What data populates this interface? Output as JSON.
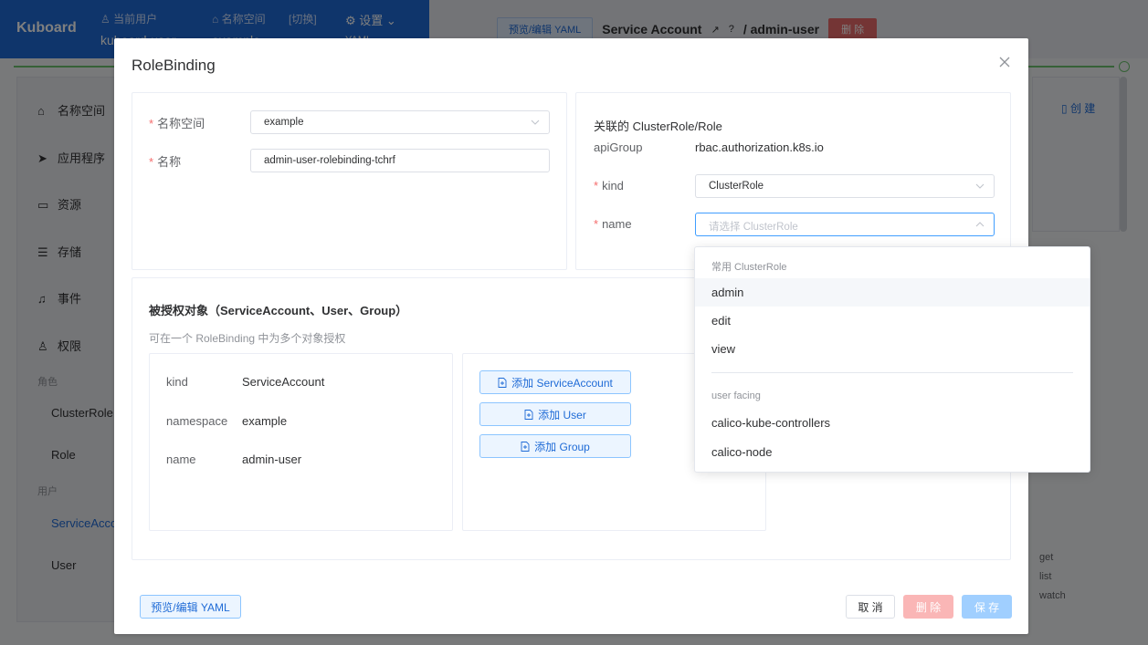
{
  "app": {
    "brand": "Kuboard",
    "current_user_label": "当前用户",
    "current_user_value": "kuboard-user",
    "namespace_label": "名称空间",
    "namespace_switch": "[切换]",
    "namespace_value": "example",
    "settings_label": "设置",
    "settings_sub": "YAML",
    "preview_yaml_btn": "预览/编辑 YAML",
    "resource_title": "Service Account",
    "resource_name": "/ admin-user",
    "delete_btn": "删 除",
    "create_btn": "创 建",
    "verbs": [
      "get",
      "list",
      "watch"
    ]
  },
  "sidebar": {
    "items": [
      {
        "label": "名称空间",
        "icon": "home-icon"
      },
      {
        "label": "应用程序",
        "icon": "send-icon"
      },
      {
        "label": "资源",
        "icon": "briefcase-icon"
      },
      {
        "label": "存储",
        "icon": "database-icon"
      },
      {
        "label": "事件",
        "icon": "bell-icon"
      },
      {
        "label": "权限",
        "icon": "user-icon"
      }
    ],
    "group_role": "角色",
    "role_items": [
      "ClusterRole",
      "Role"
    ],
    "group_user": "用户",
    "user_items": [
      "ServiceAccount",
      "User"
    ]
  },
  "dialog": {
    "title": "RoleBinding",
    "form": {
      "namespace_label": "名称空间",
      "namespace_value": "example",
      "name_label": "名称",
      "name_value": "admin-user-rolebinding-tchrf"
    },
    "roleref": {
      "title": "关联的 ClusterRole/Role",
      "apigroup_label": "apiGroup",
      "apigroup_value": "rbac.authorization.k8s.io",
      "kind_label": "kind",
      "kind_value": "ClusterRole",
      "name_label": "name",
      "name_placeholder": "请选择 ClusterRole"
    },
    "subjects": {
      "title": "被授权对象（ServiceAccount、User、Group）",
      "hint": "可在一个 RoleBinding 中为多个对象授权",
      "subject": {
        "kind_label": "kind",
        "kind_value": "ServiceAccount",
        "namespace_label": "namespace",
        "namespace_value": "example",
        "name_label": "name",
        "name_value": "admin-user"
      },
      "add_serviceaccount": "添加 ServiceAccount",
      "add_user": "添加 User",
      "add_group": "添加 Group"
    },
    "footer": {
      "yaml": "预览/编辑 YAML",
      "cancel": "取 消",
      "delete": "删 除",
      "save": "保 存"
    }
  },
  "dropdown": {
    "group1": "常用 ClusterRole",
    "group1_items": [
      "admin",
      "edit",
      "view"
    ],
    "group2": "user facing",
    "group2_items": [
      "calico-kube-controllers",
      "calico-node"
    ],
    "hovered_item": "admin"
  },
  "colors": {
    "primary": "#1f6bd6",
    "required": "#f56c6c",
    "success_line": "#6cc26f"
  }
}
